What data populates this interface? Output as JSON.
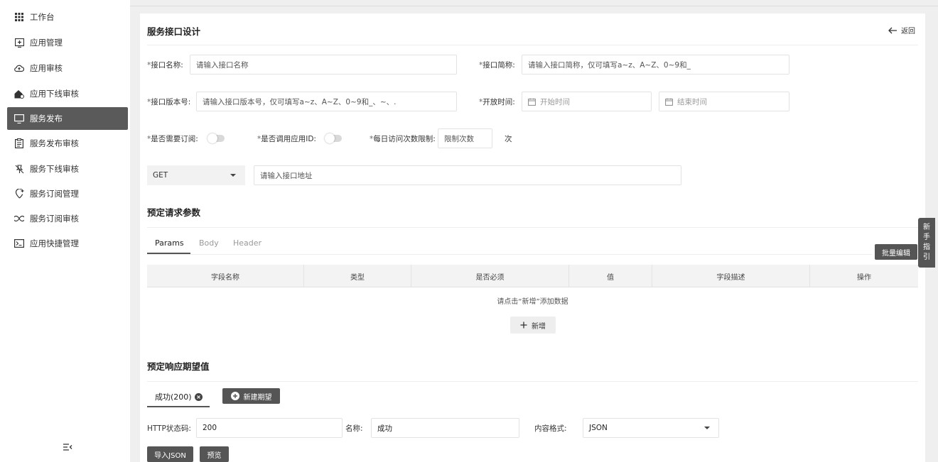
{
  "sidebar": {
    "items": [
      {
        "label": "工作台",
        "icon": "grid-icon"
      },
      {
        "label": "应用管理",
        "icon": "app-add-icon"
      },
      {
        "label": "应用审核",
        "icon": "cloud-upload-icon"
      },
      {
        "label": "应用下线审核",
        "icon": "house-cloud-icon"
      },
      {
        "label": "服务发布",
        "icon": "monitor-icon"
      },
      {
        "label": "服务发布审核",
        "icon": "clipboard-icon"
      },
      {
        "label": "服务下线审核",
        "icon": "pin-off-icon"
      },
      {
        "label": "服务订阅管理",
        "icon": "pin-badge-icon"
      },
      {
        "label": "服务订阅审核",
        "icon": "infinity-icon"
      },
      {
        "label": "应用快捷管理",
        "icon": "terminal-icon"
      }
    ],
    "active_index": 4,
    "collapse_icon": "collapse-menu-icon"
  },
  "header": {
    "title": "服务接口设计",
    "back_label": "返回"
  },
  "form": {
    "required_mark": "*",
    "name_label": "接口名称:",
    "name_placeholder": "请输入接口名称",
    "abbr_label": "接口简称:",
    "abbr_placeholder": "请输入接口简称，仅可填写a~z、A~Z、0~9和_",
    "version_label": "接口版本号:",
    "version_placeholder": "请输入接口版本号，仅可填写a~z、A~Z、0~9和_、~、.",
    "open_time_label": "开放时间:",
    "start_placeholder": "开始时间",
    "end_placeholder": "结束时间",
    "subscribe_label": "是否需要订阅:",
    "subscribe_on": false,
    "app_id_label": "是否调用应用ID:",
    "app_id_on": false,
    "daily_limit_label": "每日访问次数限制:",
    "daily_limit_placeholder": "限制次数",
    "daily_limit_unit": "次",
    "method": "GET",
    "url_placeholder": "请输入接口地址"
  },
  "request_params": {
    "title": "预定请求参数",
    "tabs": [
      "Params",
      "Body",
      "Header"
    ],
    "active_tab": 0,
    "batch_edit_label": "批量编辑",
    "columns": [
      "字段名称",
      "类型",
      "是否必须",
      "值",
      "字段描述",
      "操作"
    ],
    "empty_text": "请点击“新增”添加数据",
    "add_label": "新增"
  },
  "response": {
    "title": "预定响应期望值",
    "tab_label": "成功(200)",
    "new_label": "新建期望",
    "status_code_label": "HTTP状态码:",
    "status_code_value": "200",
    "name_label": "名称:",
    "name_value": "成功",
    "format_label": "内容格式:",
    "format_value": "JSON",
    "import_label": "导入JSON",
    "preview_label": "预览"
  },
  "guide": {
    "chars": [
      "新",
      "手",
      "指",
      "引"
    ]
  }
}
